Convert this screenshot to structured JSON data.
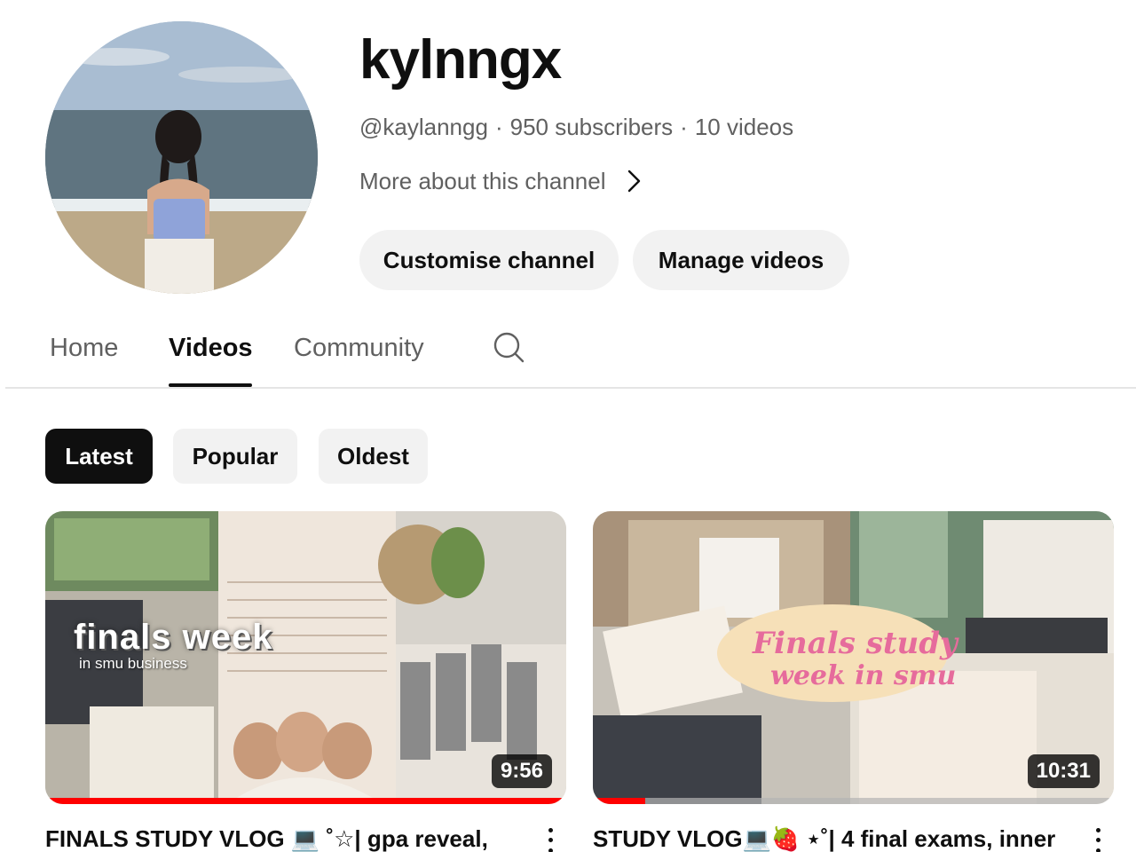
{
  "channel": {
    "name": "kylnngx",
    "handle": "@kaylanngg",
    "subscribers": "950 subscribers",
    "videos_count": "10 videos",
    "separator": "·",
    "more_about": "More about this channel",
    "customise_label": "Customise channel",
    "manage_label": "Manage videos"
  },
  "tabs": [
    {
      "label": "Home",
      "active": false
    },
    {
      "label": "Videos",
      "active": true
    },
    {
      "label": "Community",
      "active": false
    }
  ],
  "chips": [
    {
      "label": "Latest",
      "active": true
    },
    {
      "label": "Popular",
      "active": false
    },
    {
      "label": "Oldest",
      "active": false
    }
  ],
  "videos": [
    {
      "title": "FINALS STUDY VLOG 💻 ˚☆| gpa reveal,",
      "duration": "9:56",
      "thumb_text": "finals week",
      "thumb_subtext": "in smu business",
      "watched_fraction": 1.0
    },
    {
      "title": "STUDY VLOG💻🍓 ⋆˚| 4 final exams, inner",
      "duration": "10:31",
      "watched_fraction": 0.1
    }
  ],
  "colors": {
    "progress": "#ff0000",
    "chip_active_bg": "#0f0f0f",
    "pill_bg": "#f2f2f2",
    "secondary_text": "#606060"
  }
}
